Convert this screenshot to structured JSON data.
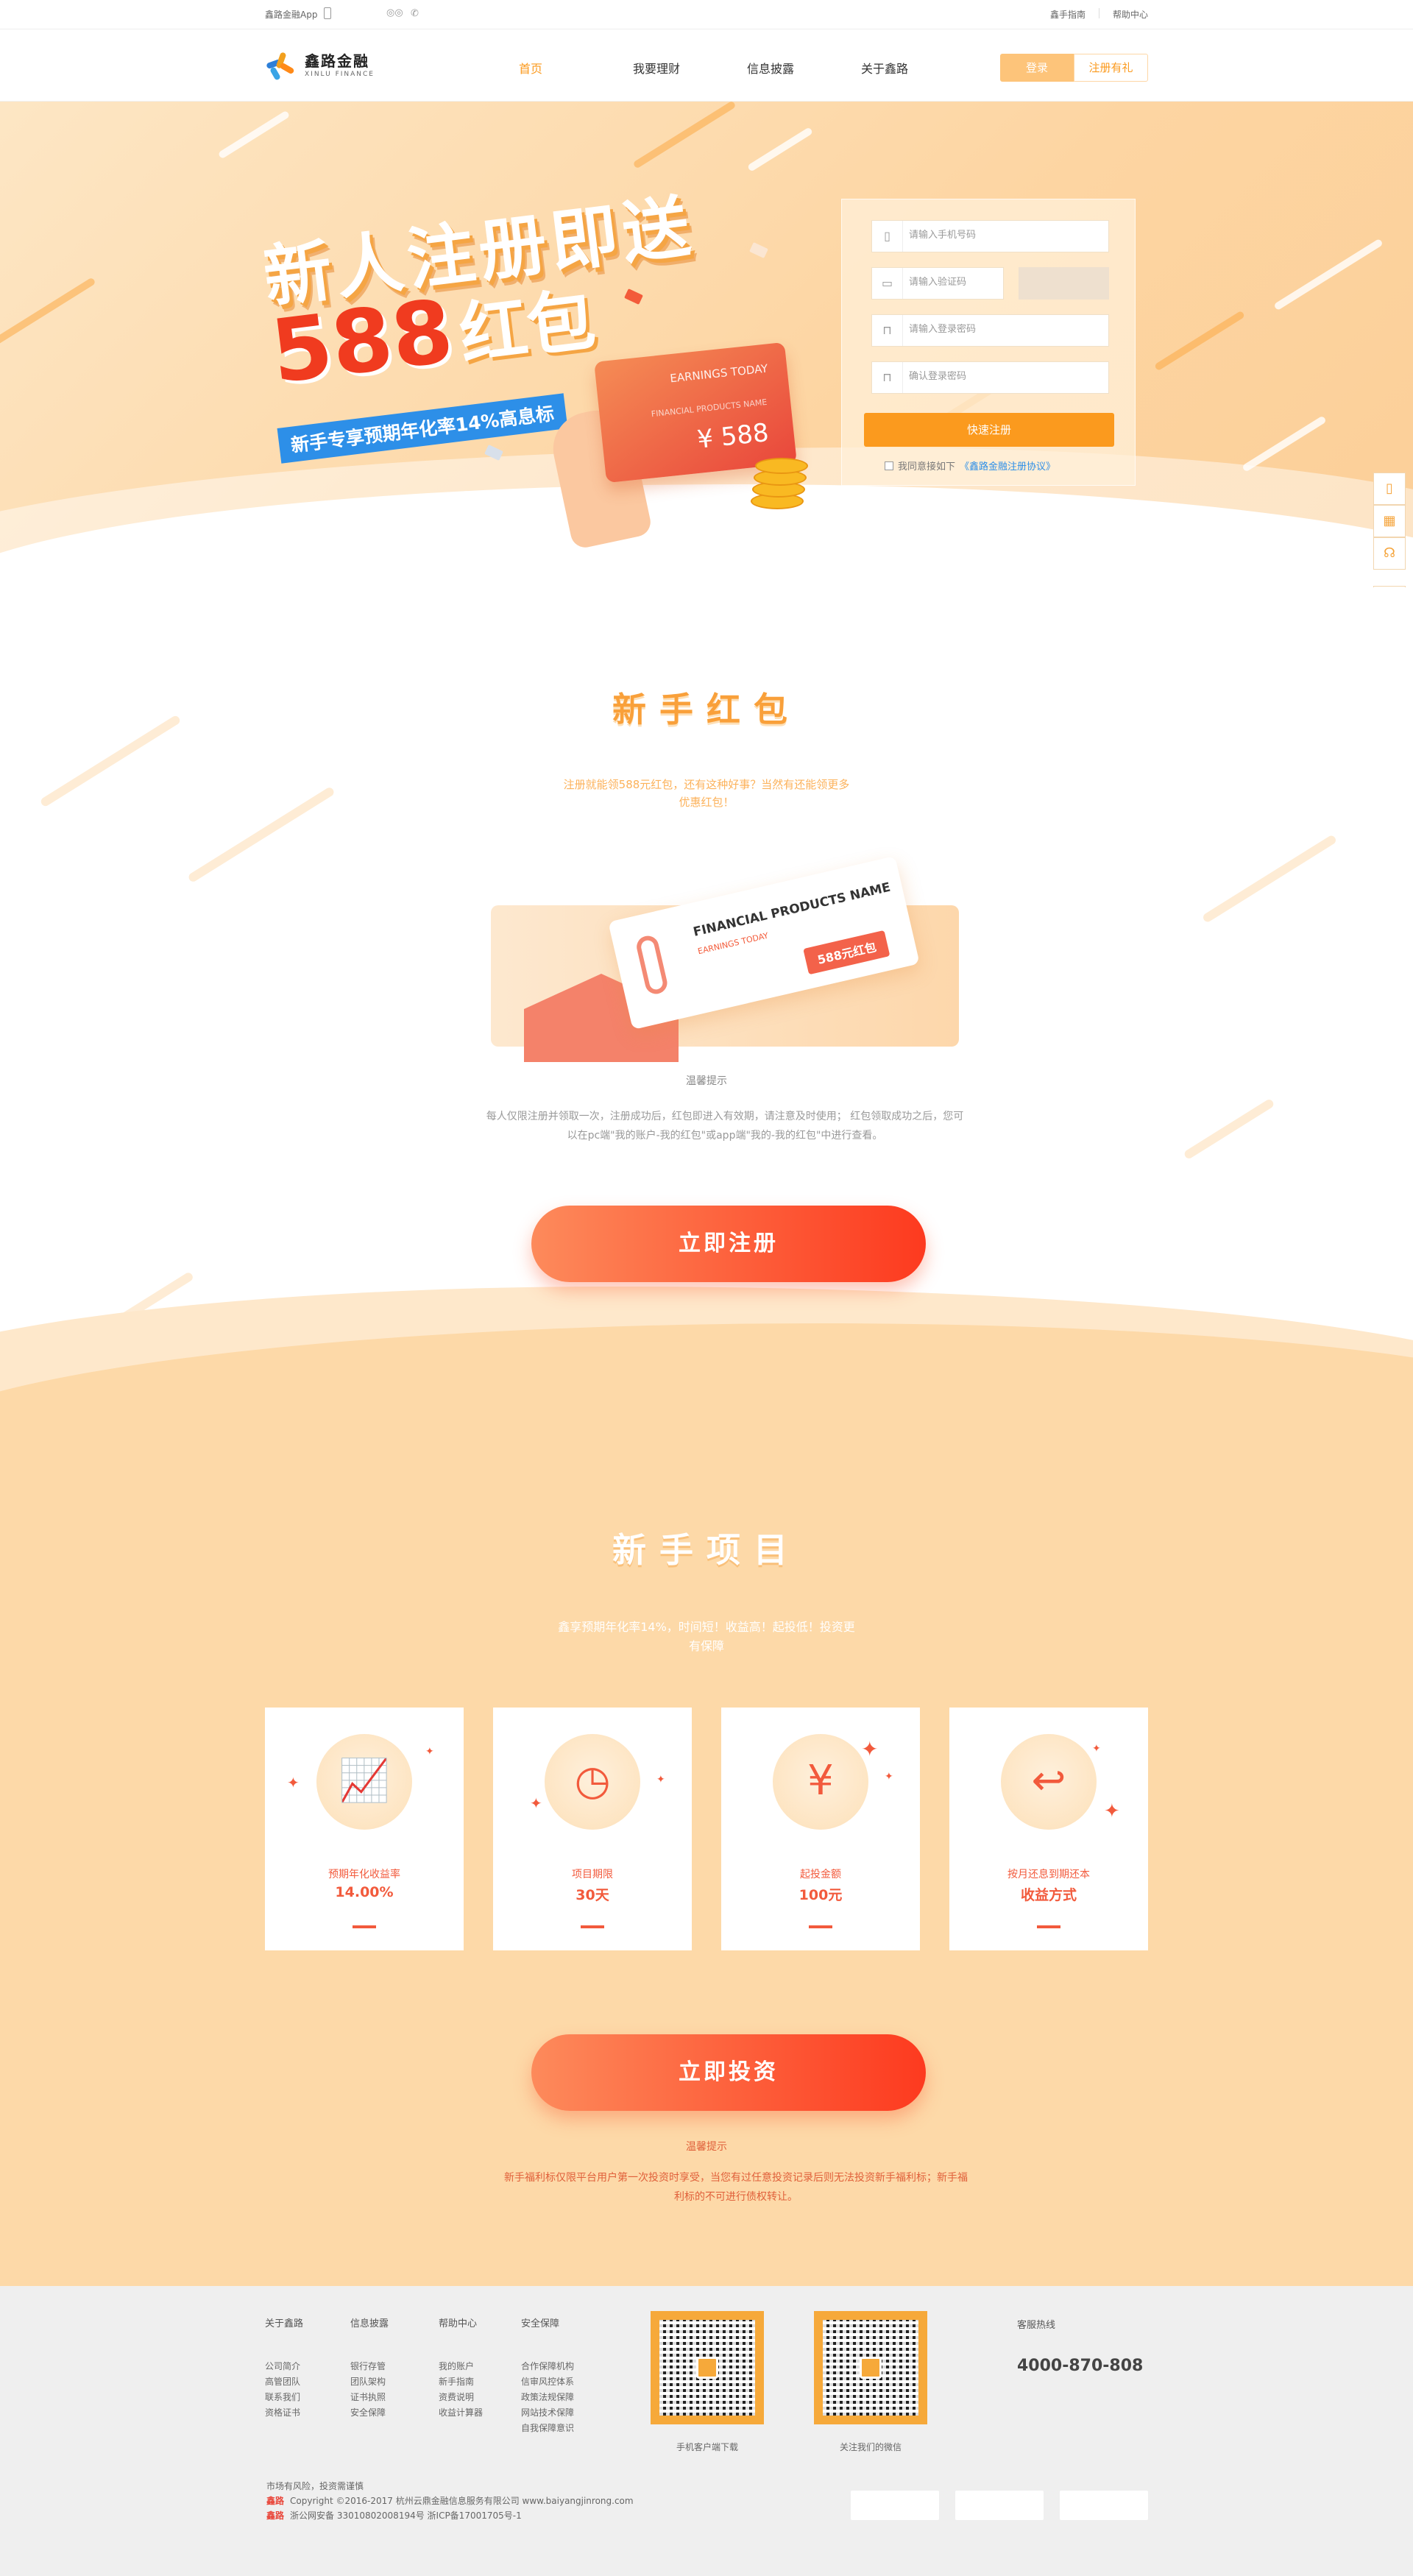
{
  "topbar": {
    "app_link": "鑫路金融App",
    "right_links": [
      "鑫手指南",
      "帮助中心"
    ]
  },
  "nav": {
    "logo_cn": "鑫路金融",
    "logo_en": "XINLU FINANCE",
    "links": [
      "首页",
      "我要理财",
      "信息披露",
      "关于鑫路"
    ],
    "login": "登录",
    "register": "注册有礼"
  },
  "hero": {
    "headline": "新人注册即送",
    "amount": "588",
    "amount_word": "红包",
    "subtag": "新手专享预期年化率14%高息标",
    "card_title": "EARNINGS TODAY",
    "card_product": "FINANCIAL PRODUCTS NAME",
    "card_amount": "¥ 588",
    "form": {
      "phone_placeholder": "请输入手机号码",
      "captcha_placeholder": "请输入验证码",
      "password_placeholder": "请输入登录密码",
      "confirm_placeholder": "确认登录密码",
      "submit": "快速注册",
      "agree_text": "我同意接如下",
      "agree_link": "《鑫路金融注册协议》"
    }
  },
  "redpacket": {
    "title": "新手红包",
    "desc": "注册就能领588元红包，还有这种好事？当然有还能领更多优惠红包！",
    "ticket_name": "FINANCIAL PRODUCTS NAME",
    "ticket_sub": "EARNINGS TODAY",
    "ticket_badge": "588元红包",
    "tip_title": "温馨提示",
    "tip_text": "每人仅限注册并领取一次，注册成功后，红包即进入有效期，请注意及时使用；  红包领取成功之后，您可以在pc端\"我的账户-我的红包\"或app端\"我的-我的红包\"中进行查看。",
    "button": "立即注册"
  },
  "projects": {
    "title": "新手项目",
    "desc": "鑫享预期年化率14%，时间短！收益高！起投低！投资更有保障",
    "cards": [
      {
        "label": "预期年化收益率",
        "value": "14.00%",
        "icon": "chart-up-icon"
      },
      {
        "label": "项目期限",
        "value": "30天",
        "icon": "clock-icon"
      },
      {
        "label": "起投金额",
        "value": "100元",
        "icon": "coins-icon"
      },
      {
        "label": "按月还息到期还本",
        "value": "收益方式",
        "icon": "return-icon"
      }
    ],
    "button": "立即投资",
    "tip_title": "温馨提示",
    "tip_text": "新手福利标仅限平台用户第一次投资时享受，当您有过任意投资记录后则无法投资新手福利标；新手福利标的不可进行债权转让。"
  },
  "footer": {
    "columns": [
      {
        "head": "关于鑫路",
        "items": [
          "公司简介",
          "高管团队",
          "联系我们",
          "资格证书"
        ]
      },
      {
        "head": "信息披露",
        "items": [
          "银行存管",
          "团队架构",
          "证书执照",
          "安全保障"
        ]
      },
      {
        "head": "帮助中心",
        "items": [
          "我的账户",
          "新手指南",
          "资费说明",
          "收益计算器"
        ]
      },
      {
        "head": "安全保障",
        "items": [
          "合作保障机构",
          "信审风控体系",
          "政策法规保障",
          "网站技术保障",
          "自我保障意识"
        ]
      }
    ],
    "qr_app_caption": "手机客户端下载",
    "qr_wechat_caption": "关注我们的微信",
    "hotline_label": "客服热线",
    "hotline": "4000-870-808",
    "risk": "市场有风险，投资需谨慎",
    "copyright_label": "鑫路",
    "copyright": "Copyright ©2016-2017 杭州云鼎金融信息服务有限公司 www.baiyangjinrong.com",
    "icp_label": "鑫路",
    "icp": "浙公网安备 33010802008194号 浙ICP备17001705号-1"
  }
}
